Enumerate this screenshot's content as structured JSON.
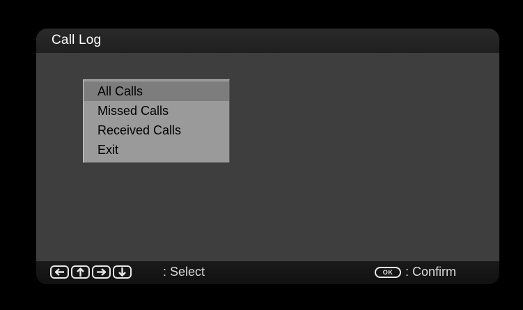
{
  "window": {
    "title": "Call Log"
  },
  "menu": {
    "items": [
      {
        "label": "All Calls",
        "selected": true
      },
      {
        "label": "Missed Calls",
        "selected": false
      },
      {
        "label": "Received Calls",
        "selected": false
      },
      {
        "label": "Exit",
        "selected": false
      }
    ]
  },
  "footer": {
    "nav_keys": [
      "arrow-left-icon",
      "arrow-up-icon",
      "arrow-right-icon",
      "arrow-down-icon"
    ],
    "select_label": ": Select",
    "ok_key_label": "OK",
    "confirm_label": ": Confirm"
  },
  "colors": {
    "background": "#000000",
    "panel": "#3e3e3e",
    "menu_bg": "#9a9a9a",
    "menu_selected": "#7d7d7d",
    "title_text": "#ffffff"
  }
}
